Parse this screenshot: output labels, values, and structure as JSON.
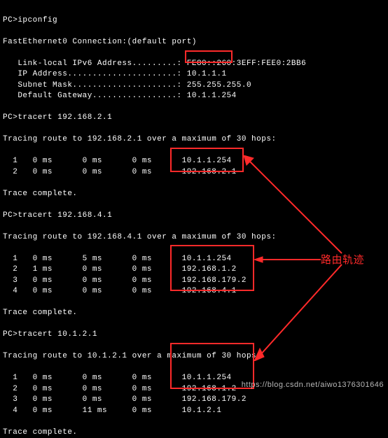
{
  "prompt": "PC>",
  "cmd_ipconfig": "ipconfig",
  "ipconfig": {
    "header": "FastEthernet0 Connection:(default port)",
    "link_local_label": "Link-local IPv6 Address.........",
    "link_local_value": "FE80::260:3EFF:FEE0:2BB6",
    "ip_label": "IP Address......................",
    "ip_value": "10.1.1.1",
    "mask_label": "Subnet Mask.....................",
    "mask_value": "255.255.255.0",
    "gw_label": "Default Gateway.................",
    "gw_value": "10.1.1.254"
  },
  "sep": ": ",
  "tracert1": {
    "cmd": "tracert 192.168.2.1",
    "header": "Tracing route to 192.168.2.1 over a maximum of 30 hops:",
    "r1": "  1   0 ms      0 ms      0 ms      10.1.1.254",
    "r2": "  2   0 ms      0 ms      0 ms      192.168.2.1",
    "complete": "Trace complete."
  },
  "tracert2": {
    "cmd": "tracert 192.168.4.1",
    "header": "Tracing route to 192.168.4.1 over a maximum of 30 hops:",
    "r1": "  1   0 ms      5 ms      0 ms      10.1.1.254",
    "r2": "  2   1 ms      0 ms      0 ms      192.168.1.2",
    "r3": "  3   0 ms      0 ms      0 ms      192.168.179.2",
    "r4": "  4   0 ms      0 ms      0 ms      192.168.4.1",
    "complete": "Trace complete."
  },
  "tracert3": {
    "cmd": "tracert 10.1.2.1",
    "header": "Tracing route to 10.1.2.1 over a maximum of 30 hops:",
    "r1": "  1   0 ms      0 ms      0 ms      10.1.1.254",
    "r2": "  2   0 ms      0 ms      0 ms      192.168.1.2",
    "r3": "  3   0 ms      0 ms      0 ms      192.168.179.2",
    "r4": "  4   0 ms      11 ms     0 ms      10.1.2.1",
    "complete": "Trace complete."
  },
  "annotation": "路由轨迹",
  "watermark": "https://blog.csdn.net/aiwo1376301646"
}
